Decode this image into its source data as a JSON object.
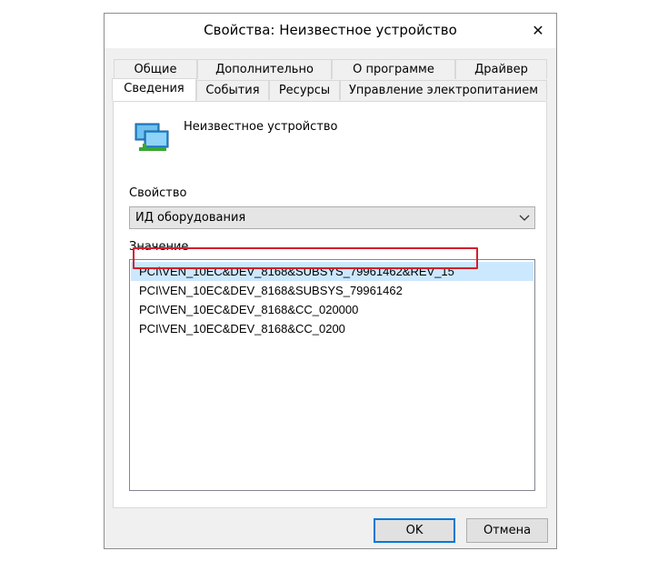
{
  "window": {
    "title": "Свойства: Неизвестное устройство",
    "close_glyph": "✕"
  },
  "tabs_row1": [
    "Общие",
    "Дополнительно",
    "О программе",
    "Драйвер"
  ],
  "tabs_row2": [
    "Сведения",
    "События",
    "Ресурсы",
    "Управление электропитанием"
  ],
  "active_tab": "Сведения",
  "device": {
    "name": "Неизвестное устройство",
    "icon": "network-adapter-icon"
  },
  "property": {
    "label": "Свойство",
    "selected": "ИД оборудования"
  },
  "value": {
    "label": "Значение",
    "items": [
      "PCI\\VEN_10EC&DEV_8168&SUBSYS_79961462&REV_15",
      "PCI\\VEN_10EC&DEV_8168&SUBSYS_79961462",
      "PCI\\VEN_10EC&DEV_8168&CC_020000",
      "PCI\\VEN_10EC&DEV_8168&CC_0200"
    ],
    "selected_index": 0
  },
  "buttons": {
    "ok": "OK",
    "cancel": "Отмена"
  },
  "colors": {
    "highlight_border": "#d21f2d",
    "selection_bg": "#cce8ff",
    "accent": "#0078d7"
  }
}
